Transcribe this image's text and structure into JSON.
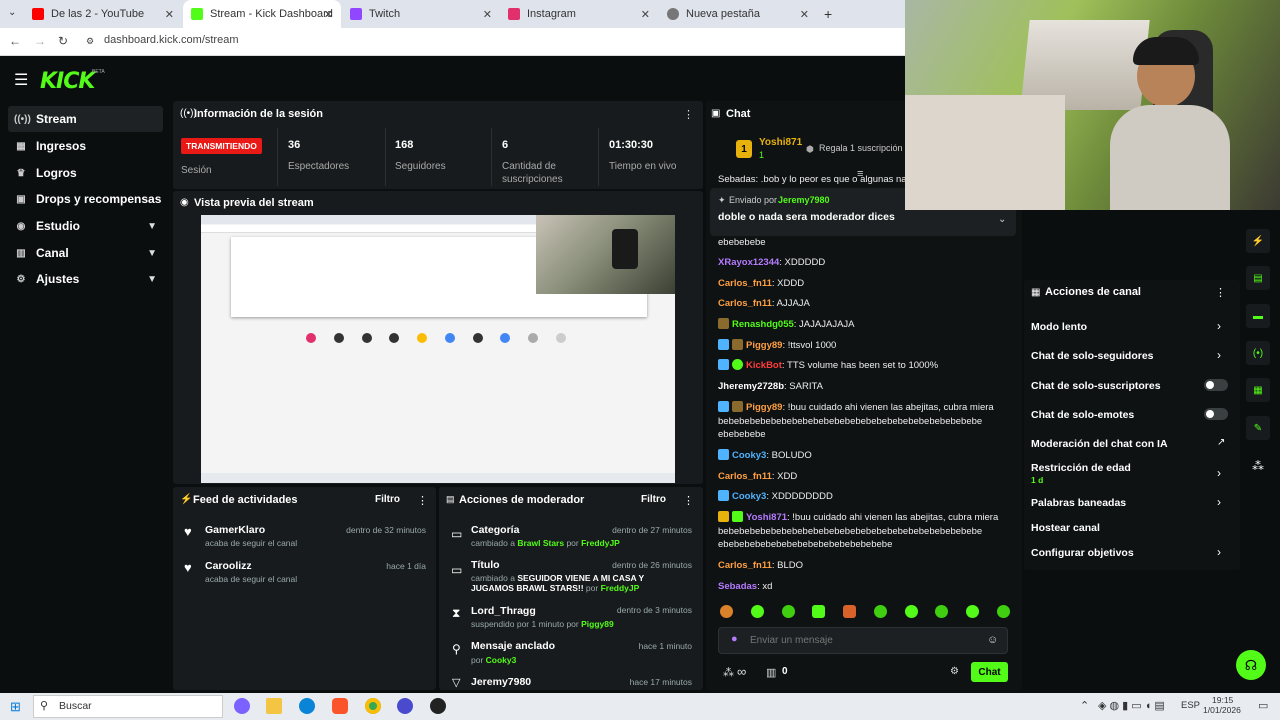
{
  "browser": {
    "tabs": [
      {
        "title": "De las 2 - YouTube",
        "color": "#ff0000"
      },
      {
        "title": "Stream - Kick Dashboard",
        "color": "#53fc18"
      },
      {
        "title": "Twitch",
        "color": "#9146ff"
      },
      {
        "title": "Instagram",
        "color": "#e1306c"
      },
      {
        "title": "Nueva pestaña",
        "color": "#777777"
      }
    ],
    "url": "dashboard.kick.com/stream"
  },
  "app": {
    "logo": "KICK",
    "beta": "BETA"
  },
  "sidebar": {
    "items": [
      {
        "label": "Stream",
        "icon": "stream-icon"
      },
      {
        "label": "Ingresos",
        "icon": "revenue-icon"
      },
      {
        "label": "Logros",
        "icon": "trophy-icon"
      },
      {
        "label": "Drops y recompensas",
        "icon": "gift-icon"
      },
      {
        "label": "Estudio",
        "icon": "studio-icon"
      },
      {
        "label": "Canal",
        "icon": "channel-icon"
      },
      {
        "label": "Ajustes",
        "icon": "gear-icon"
      }
    ]
  },
  "session": {
    "title": "Información de la sesión",
    "status": "TRANSMITIENDO",
    "status_label": "Sesión",
    "viewers": "36",
    "viewers_label": "Espectadores",
    "followers": "168",
    "followers_label": "Seguidores",
    "subs": "6",
    "subs_label": "Cantidad de suscripciones",
    "time": "01:30:30",
    "time_label": "Tiempo en vivo"
  },
  "preview": {
    "title": "Vista previa del stream"
  },
  "feed": {
    "title": "Feed de actividades",
    "filter": "Filtro",
    "items": [
      {
        "name": "GamerKlaro",
        "action": "acaba de seguir el canal",
        "time": "dentro de 32 minutos"
      },
      {
        "name": "Caroolizz",
        "action": "acaba de seguir el canal",
        "time": "hace 1 día"
      }
    ]
  },
  "modactions": {
    "title": "Acciones de moderador",
    "filter": "Filtro",
    "items": [
      {
        "title": "Categoría",
        "l1": "cambiado a ",
        "h1": "Brawl Stars",
        "l2": " por ",
        "h2": "FreddyJP",
        "time": "dentro de 27 minutos"
      },
      {
        "title": "Título",
        "l1": "cambiado a ",
        "bold": "SEGUIDOR VIENE A MI CASA Y JUGAMOS BRAWL STARS!!",
        "l2": " por ",
        "h2": "FreddyJP",
        "time": "dentro de 26 minutos"
      },
      {
        "title": "Lord_Thragg",
        "l1": "suspendido por 1 minuto por ",
        "h2": "Piggy89",
        "time": "dentro de 3 minutos"
      },
      {
        "title": "Mensaje anclado",
        "l1": "por ",
        "h2": "Cooky3",
        "time": "hace 1 minuto"
      },
      {
        "title": "Jeremy7980",
        "time": "hace 17 minutos"
      }
    ]
  },
  "chat": {
    "title": "Chat",
    "gift_user": "Yoshi871",
    "gift_rank": "1",
    "gift_count": "1",
    "gift_text": "Regala 1 suscripción p",
    "cut_line": "Sebadas: .bob y lo peor es que o algunas nac",
    "pinned_by_label": "Enviado por",
    "pinned_by": "Jeremy7980",
    "pinned_text": "doble o nada sera moderador dices",
    "messages": [
      {
        "user": "",
        "text": "ebebebebe",
        "color": "#eeeeee"
      },
      {
        "user": "XRayox12344",
        "text": ": XDDDDD",
        "color": "#b57bff"
      },
      {
        "user": "Carlos_fn11",
        "text": ": XDDD",
        "color": "#ff9f43"
      },
      {
        "user": "Carlos_fn11",
        "text": ": AJJAJA",
        "color": "#ff9f43"
      },
      {
        "user": "Renashdg055",
        "text": ": JAJAJAJAJA",
        "color": "#53fc18"
      },
      {
        "user": "Piggy89",
        "text": ": !ttsvol 1000",
        "color": "#ff9f43"
      },
      {
        "user": "KickBot",
        "text": ": TTS volume has been set to 1000%",
        "color": "#ff3b3b"
      },
      {
        "user": "Jheremy2728b",
        "text": ": SARITA",
        "color": "#ffffff"
      },
      {
        "user": "Piggy89",
        "text": ": !buu cuidado ahi vienen las abejitas, cubra miera bebebebebebebebebebebebebebebebebebebebebebebebebe ebebebebe",
        "color": "#ff9f43"
      },
      {
        "user": "Cooky3",
        "text": ": BOLUDO",
        "color": "#4fb3ff"
      },
      {
        "user": "Carlos_fn11",
        "text": ": XDD",
        "color": "#ff9f43"
      },
      {
        "user": "Cooky3",
        "text": ": XDDDDDDDD",
        "color": "#4fb3ff"
      },
      {
        "user": "Yoshi871",
        "text": ": !buu cuidado ahi vienen las abejitas, cubra miera bebebebebebebebebebebebebebebebebebebebebebebebebe ebebebebebebebebebebebebebebebebe",
        "color": "#b57bff"
      },
      {
        "user": "Carlos_fn11",
        "text": ": BLDO",
        "color": "#ff9f43"
      },
      {
        "user": "Sebadas",
        "text": ": xd",
        "color": "#b57bff"
      }
    ],
    "input_placeholder": "Enviar un mensaje",
    "points": "∞",
    "gift_counter": "0",
    "send_label": "Chat"
  },
  "channel_actions": {
    "title": "Acciones de canal",
    "items": [
      {
        "label": "Modo lento",
        "control": "chevron"
      },
      {
        "label": "Chat de solo-seguidores",
        "control": "chevron"
      },
      {
        "label": "Chat de solo-suscriptores",
        "control": "toggle"
      },
      {
        "label": "Chat de solo-emotes",
        "control": "toggle"
      },
      {
        "label": "Moderación del chat con IA",
        "control": "external"
      },
      {
        "label": "Restricción de edad",
        "sub": "1 d",
        "control": "chevron"
      },
      {
        "label": "Palabras baneadas",
        "control": "chevron"
      },
      {
        "label": "Hostear canal",
        "control": "none"
      },
      {
        "label": "Configurar objetivos",
        "control": "chevron"
      }
    ]
  },
  "taskbar": {
    "search": "Buscar",
    "lang": "ESP",
    "time": "19:15",
    "date": "1/01/2026"
  },
  "colors": {
    "accent": "#53fc18",
    "live": "#e91916"
  }
}
